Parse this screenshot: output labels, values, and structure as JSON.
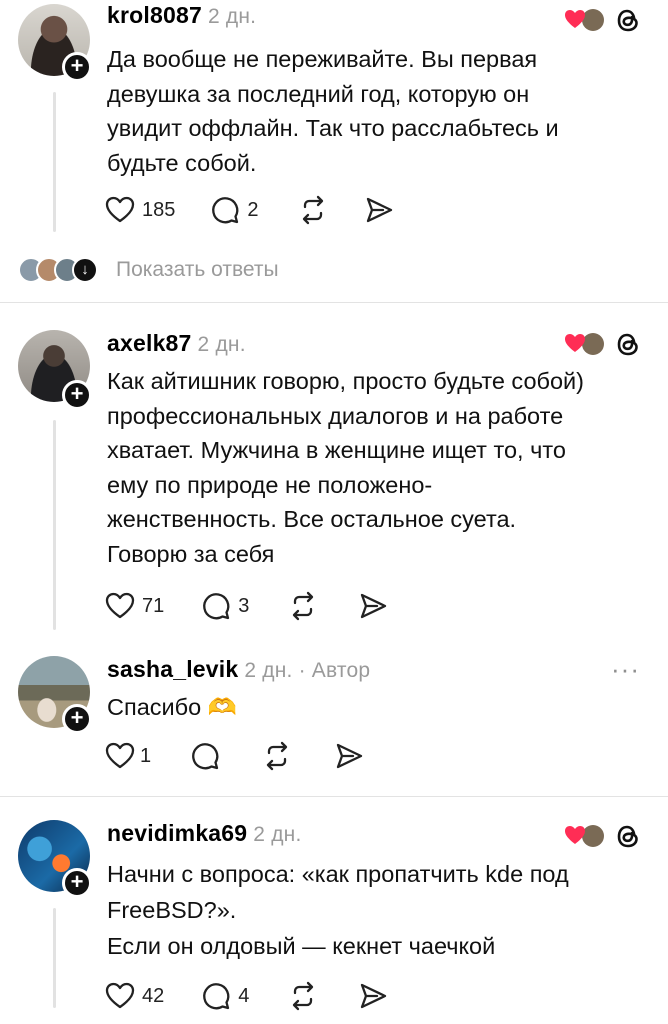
{
  "comments": [
    {
      "username": "krol8087",
      "time": "2 дн.",
      "text": "Да вообще не переживайте. Вы первая\nдевушка за последний год, которую он\nувидит оффлайн. Так что расслабьтесь и\nбудьте собой.",
      "likes": "185",
      "replies": "2"
    },
    {
      "username": "axelk87",
      "time": "2 дн.",
      "text": "Как айтишник говорю, просто будьте собой)\nпрофессиональных диалогов и на работе\nхватает. Мужчина в женщине ищет то, что\nему по природе не положено-\nженственность. Все остальное суета.\nГоворю за себя",
      "likes": "71",
      "replies": "3"
    },
    {
      "username": "sasha_levik",
      "time": "2 дн.",
      "author_badge": "· Автор",
      "text": "Спасибо 🫶",
      "likes": "1",
      "replies": ""
    },
    {
      "username": "nevidimka69",
      "time": "2 дн.",
      "text": "Начни с вопроса: «как пропатчить kde под\nFreeBSD?».\nЕсли он олдовый — кекнет чаечкой",
      "likes": "42",
      "replies": "4"
    }
  ],
  "show_replies": "Показать ответы",
  "more_glyph": "···",
  "colors": {
    "heart": "#ff2d55",
    "muted": "#9a9a9a",
    "line": "#e2e2e2"
  },
  "icons": [
    "heart-icon",
    "comment-icon",
    "repost-icon",
    "share-icon",
    "threads-icon",
    "plus-icon",
    "arrow-down-icon",
    "more-icon"
  ]
}
